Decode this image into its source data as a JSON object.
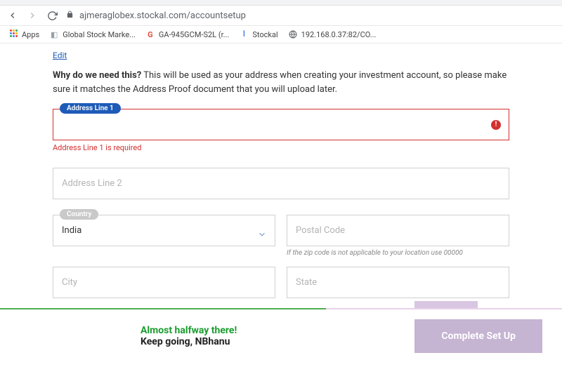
{
  "browser": {
    "url": "ajmeraglobex.stockal.com/accountsetup",
    "bookmarks": {
      "apps": "Apps",
      "global_stock": "Global Stock Marke...",
      "ga": "GA-945GCM-S2L (r...",
      "stockal": "Stockal",
      "ip": "192.168.0.37:82/CO..."
    }
  },
  "form": {
    "edit": "Edit",
    "why_bold": "Why do we need this?",
    "why_rest": " This will be used as your address when creating your investment account, so please make sure it matches the Address Proof document that you will upload later.",
    "addr1": {
      "label": "Address Line 1",
      "error": "Address Line 1 is required"
    },
    "addr2": {
      "placeholder": "Address Line 2"
    },
    "country": {
      "label": "Country",
      "value": "India"
    },
    "postal": {
      "placeholder": "Postal Code",
      "helper": "If the zip code is not applicable to your location use 00000"
    },
    "city": {
      "placeholder": "City"
    },
    "state": {
      "placeholder": "State"
    }
  },
  "footer": {
    "line1": "Almost halfway there!",
    "line2": "Keep going, NBhanu",
    "button": "Complete Set Up"
  }
}
